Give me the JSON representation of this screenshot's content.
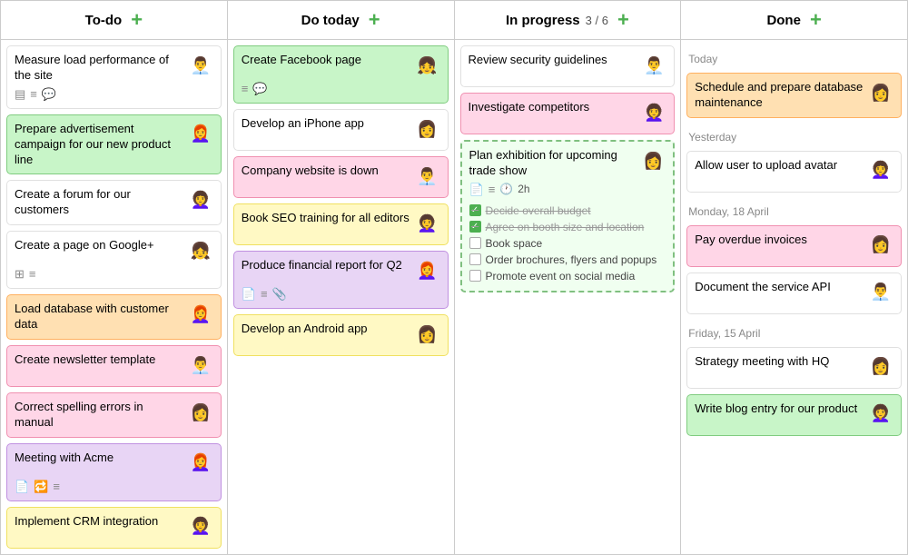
{
  "columns": [
    {
      "id": "todo",
      "label": "To-do",
      "badge": "",
      "cards": [
        {
          "id": "c1",
          "title": "Measure load performance of the site",
          "color": "c-white",
          "icons": [
            "checklist",
            "bullets",
            "chat"
          ],
          "avatar": "👨‍💼"
        },
        {
          "id": "c2",
          "title": "Prepare advertisement campaign for our new product line",
          "color": "c-green",
          "icons": [],
          "avatar": "👩‍🦰"
        },
        {
          "id": "c3",
          "title": "Create a forum for our customers",
          "color": "c-white",
          "icons": [],
          "avatar": "👩‍🦱"
        },
        {
          "id": "c4",
          "title": "Create a page on Google+",
          "color": "c-white",
          "icons": [
            "grid",
            "bullets"
          ],
          "avatar": "👧"
        },
        {
          "id": "c5",
          "title": "Load database with customer data",
          "color": "c-orange",
          "icons": [],
          "avatar": "👩‍🦰"
        },
        {
          "id": "c6",
          "title": "Create newsletter template",
          "color": "c-pink",
          "icons": [],
          "avatar": "👨‍💼"
        },
        {
          "id": "c7",
          "title": "Correct spelling errors in manual",
          "color": "c-pink",
          "icons": [],
          "avatar": "👩"
        },
        {
          "id": "c8",
          "title": "Meeting with Acme",
          "color": "c-purple",
          "icons": [
            "doc",
            "sync",
            "bullets"
          ],
          "avatar": "👩‍🦰"
        },
        {
          "id": "c9",
          "title": "Implement CRM integration",
          "color": "c-yellow",
          "icons": [],
          "avatar": "👩‍🦱"
        }
      ]
    },
    {
      "id": "dotoday",
      "label": "Do today",
      "badge": "",
      "cards": [
        {
          "id": "d1",
          "title": "Create Facebook page",
          "color": "c-green",
          "icons": [
            "bullets",
            "chat"
          ],
          "avatar": "👧"
        },
        {
          "id": "d2",
          "title": "Develop an iPhone app",
          "color": "c-white",
          "icons": [],
          "avatar": "👩"
        },
        {
          "id": "d3",
          "title": "Company website is down",
          "color": "c-pink",
          "icons": [],
          "avatar": "👨‍💼"
        },
        {
          "id": "d4",
          "title": "Book SEO training for all editors",
          "color": "c-yellow",
          "icons": [],
          "avatar": "👩‍🦱"
        },
        {
          "id": "d5",
          "title": "Produce financial report for Q2",
          "color": "c-purple",
          "icons": [
            "doc",
            "bullets",
            "clip"
          ],
          "avatar": "👩‍🦰"
        },
        {
          "id": "d6",
          "title": "Develop an Android app",
          "color": "c-yellow",
          "icons": [],
          "avatar": "👩"
        }
      ]
    },
    {
      "id": "inprogress",
      "label": "In progress",
      "badge": "3 / 6",
      "cards": [
        {
          "id": "i1",
          "title": "Review security guidelines",
          "color": "c-white",
          "icons": [],
          "avatar": "👨‍💼",
          "expanded": false
        },
        {
          "id": "i2",
          "title": "Investigate competitors",
          "color": "c-pink",
          "icons": [],
          "avatar": "👩‍🦱",
          "expanded": false
        },
        {
          "id": "i3",
          "title": "Plan exhibition for upcoming trade show",
          "color": "inprogress-expand",
          "icons": [
            "doc",
            "bullets",
            "clock"
          ],
          "timer": "2h",
          "avatar": "👩",
          "expanded": true,
          "checklist": [
            {
              "text": "Decide overall budget",
              "checked": true
            },
            {
              "text": "Agree on booth size and location",
              "checked": true
            },
            {
              "text": "Book space",
              "checked": false
            },
            {
              "text": "Order brochures, flyers and popups",
              "checked": false
            },
            {
              "text": "Promote event on social media",
              "checked": false
            }
          ]
        }
      ]
    },
    {
      "id": "done",
      "label": "Done",
      "badge": "",
      "sections": [
        {
          "label": "Today",
          "cards": [
            {
              "id": "dn1",
              "title": "Schedule and prepare database maintenance",
              "color": "c-orange",
              "avatar": "👩"
            }
          ]
        },
        {
          "label": "Yesterday",
          "cards": [
            {
              "id": "dn2",
              "title": "Allow user to upload avatar",
              "color": "c-white",
              "avatar": "👩‍🦱"
            }
          ]
        },
        {
          "label": "Monday, 18 April",
          "cards": [
            {
              "id": "dn3",
              "title": "Pay overdue invoices",
              "color": "c-pink",
              "avatar": "👩"
            },
            {
              "id": "dn4",
              "title": "Document the service API",
              "color": "c-white",
              "avatar": "👨‍💼"
            }
          ]
        },
        {
          "label": "Friday, 15 April",
          "cards": [
            {
              "id": "dn5",
              "title": "Strategy meeting with HQ",
              "color": "c-white",
              "avatar": "👩"
            },
            {
              "id": "dn6",
              "title": "Write blog entry for our product",
              "color": "c-green",
              "avatar": "👩‍🦱"
            }
          ]
        }
      ]
    }
  ]
}
